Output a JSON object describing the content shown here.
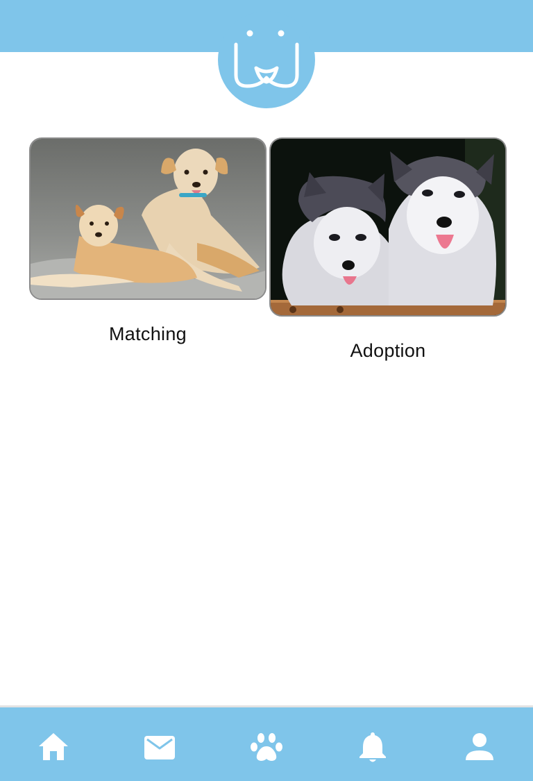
{
  "colors": {
    "brand": "#7fc5ea",
    "background": "#ffffff",
    "label_text": "#111111",
    "icon": "#ffffff"
  },
  "header": {
    "logo_icon": "dog-face-logo-icon"
  },
  "cards": {
    "matching": {
      "label": "Matching",
      "image_icon": "two-dogs-photo"
    },
    "adoption": {
      "label": "Adoption",
      "image_icon": "husky-puppies-photo"
    }
  },
  "bottom_nav": {
    "items": [
      {
        "icon": "home-icon",
        "active": true
      },
      {
        "icon": "mail-icon",
        "active": false
      },
      {
        "icon": "paw-icon",
        "active": false
      },
      {
        "icon": "bell-icon",
        "active": false
      },
      {
        "icon": "user-icon",
        "active": false
      }
    ]
  }
}
